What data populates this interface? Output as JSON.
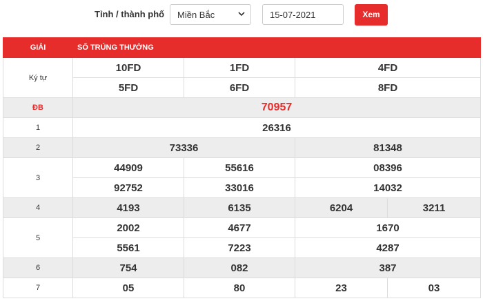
{
  "filter": {
    "label": "Tỉnh / thành phố",
    "province": "Miền Bắc",
    "date": "15-07-2021",
    "submit": "Xem"
  },
  "table": {
    "col_prize": "GIẢI",
    "col_numbers": "SỐ TRÚNG THƯỞNG",
    "kytu_label": "Ký tự",
    "kytu": [
      "10FD",
      "1FD",
      "4FD",
      "5FD",
      "6FD",
      "8FD"
    ],
    "db_label": "ĐB",
    "db": "70957",
    "g1_label": "1",
    "g1": "26316",
    "g2_label": "2",
    "g2": [
      "73336",
      "81348"
    ],
    "g3_label": "3",
    "g3": [
      "44909",
      "55616",
      "08396",
      "92752",
      "33016",
      "14032"
    ],
    "g4_label": "4",
    "g4": [
      "4193",
      "6135",
      "6204",
      "3211"
    ],
    "g5_label": "5",
    "g5": [
      "2002",
      "4677",
      "1670",
      "5561",
      "7223",
      "4287"
    ],
    "g6_label": "6",
    "g6": [
      "754",
      "082",
      "387"
    ],
    "g7_label": "7",
    "g7": [
      "05",
      "80",
      "23",
      "03"
    ]
  },
  "colors": {
    "accent": "#e72c2c",
    "stripe": "#ededed"
  }
}
